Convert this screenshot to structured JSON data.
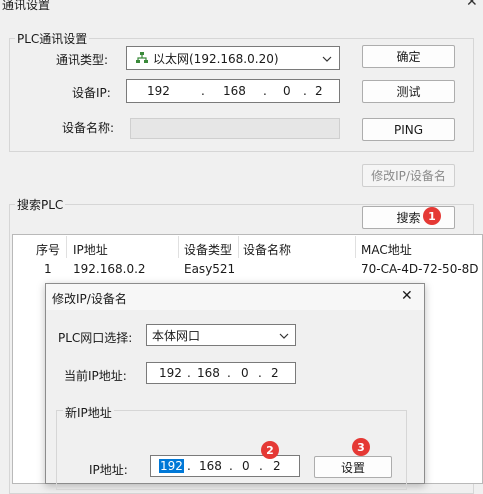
{
  "window": {
    "title": "通讯设置"
  },
  "plc_group": {
    "title": "PLC通讯设置",
    "comm_type_label": "通讯类型:",
    "comm_type_value": "以太网(192.168.0.20)",
    "device_ip_label": "设备IP:",
    "device_ip": [
      "192",
      "168",
      "0",
      "2"
    ],
    "device_name_label": "设备名称:",
    "confirm_label": "确定",
    "test_label": "测试",
    "ping_label": "PING",
    "modify_ip_label": "修改IP/设备名"
  },
  "search_group": {
    "title": "搜索PLC",
    "search_label": "搜索",
    "badge_1": "1",
    "columns": [
      "序号",
      "IP地址",
      "设备类型",
      "设备名称",
      "MAC地址"
    ],
    "rows": [
      {
        "no": "1",
        "ip": "192.168.0.2",
        "type": "Easy521",
        "name": "",
        "mac": "70-CA-4D-72-50-8D"
      }
    ]
  },
  "dialog": {
    "title": "修改IP/设备名",
    "close_glyph": "✕",
    "port_label": "PLC网口选择:",
    "port_value": "本体网口",
    "current_ip_label": "当前IP地址:",
    "current_ip": [
      "192",
      "168",
      "0",
      "2"
    ],
    "new_group_title": "新IP地址",
    "ip_label": "IP地址:",
    "new_ip": [
      "192",
      "168",
      "0",
      "2"
    ],
    "set_label": "设置",
    "badge_2": "2",
    "badge_3": "3"
  },
  "colors": {
    "badge": "#e53935",
    "selection": "#0078d7"
  }
}
